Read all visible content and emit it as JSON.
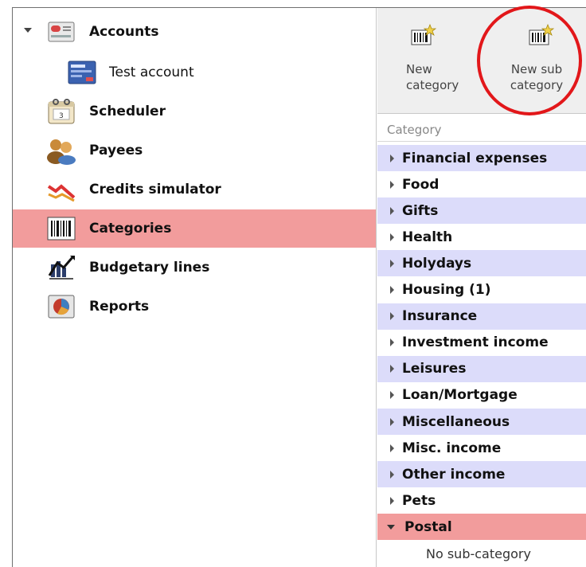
{
  "nav": {
    "items": [
      {
        "label": "Accounts",
        "icon": "accounts-icon"
      },
      {
        "label": "Test account",
        "icon": "account-card-icon"
      },
      {
        "label": "Scheduler",
        "icon": "calendar-icon"
      },
      {
        "label": "Payees",
        "icon": "payees-icon"
      },
      {
        "label": "Credits simulator",
        "icon": "chart-down-icon"
      },
      {
        "label": "Categories",
        "icon": "barcode-icon"
      },
      {
        "label": "Budgetary lines",
        "icon": "budget-chart-icon"
      },
      {
        "label": "Reports",
        "icon": "pie-chart-icon"
      }
    ],
    "selected": "Categories"
  },
  "toolbar": {
    "new_category_label": "New\ncategory",
    "new_sub_category_label": "New sub\ncategory"
  },
  "categories": {
    "header": "Category",
    "items": [
      "Financial expenses",
      "Food",
      "Gifts",
      "Health",
      "Holydays",
      "Housing (1)",
      "Insurance",
      "Investment income",
      "Leisures",
      "Loan/Mortgage",
      "Miscellaneous",
      "Misc. income",
      "Other income",
      "Pets",
      "Postal"
    ],
    "selected": "Postal",
    "sub_placeholder": "No sub-category"
  },
  "colors": {
    "selected": "#f29c9c",
    "band": "#dcdcfa",
    "highlight_circle": "#e2171a"
  }
}
